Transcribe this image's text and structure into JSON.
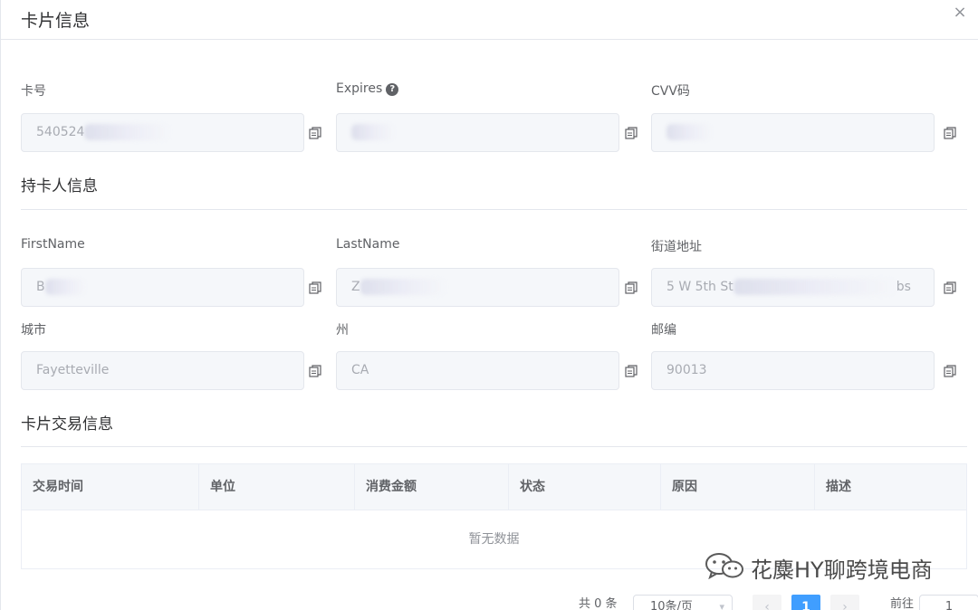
{
  "dialog": {
    "title": "卡片信息",
    "close_glyph": "×"
  },
  "card": {
    "number_label": "卡号",
    "number_value": "540524",
    "expires_label": "Expires",
    "expires_help_glyph": "?",
    "cvv_label": "CVV码"
  },
  "holder": {
    "section_title": "持卡人信息",
    "firstname_label": "FirstName",
    "firstname_value": "B",
    "lastname_label": "LastName",
    "lastname_value": "Z",
    "street_label": "街道地址",
    "street_value": "5 W 5th St",
    "street_suffix": "bs",
    "city_label": "城市",
    "city_value": "Fayetteville",
    "state_label": "州",
    "state_value": "CA",
    "zip_label": "邮编",
    "zip_value": "90013"
  },
  "transactions": {
    "section_title": "卡片交易信息",
    "columns": [
      "交易时间",
      "单位",
      "消费金额",
      "状态",
      "原因",
      "描述"
    ],
    "empty_text": "暂无数据"
  },
  "pagination": {
    "total_text": "共 0 条",
    "page_size": "10条/页",
    "current_page": "1",
    "prev_glyph": "‹",
    "next_glyph": "›",
    "goto_label": "前往",
    "goto_value": "1"
  },
  "watermark": {
    "text": "花麋HY聊跨境电商"
  },
  "icons": {
    "copy": "copy-icon",
    "close": "close-icon",
    "help": "question-circle-icon",
    "wechat": "wechat-icon"
  },
  "colors": {
    "primary": "#409eff",
    "border": "#e4e7ed",
    "field_bg": "#f5f7fa"
  }
}
